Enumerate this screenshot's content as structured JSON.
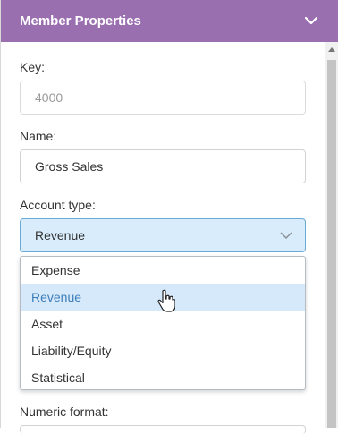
{
  "panel": {
    "title": "Member Properties",
    "collapse_icon": "chevron-down-icon",
    "header_color": "#9a6fb0"
  },
  "fields": {
    "key_label": "Key:",
    "key_value": "4000",
    "name_label": "Name:",
    "name_value": "Gross Sales",
    "account_type_label": "Account type:",
    "account_type_value": "Revenue",
    "numeric_format_label": "Numeric format:"
  },
  "dropdown": {
    "options": [
      "Expense",
      "Revenue",
      "Asset",
      "Liability/Equity",
      "Statistical"
    ],
    "highlighted": "Revenue",
    "highlight_color": "#d6e9fb"
  }
}
